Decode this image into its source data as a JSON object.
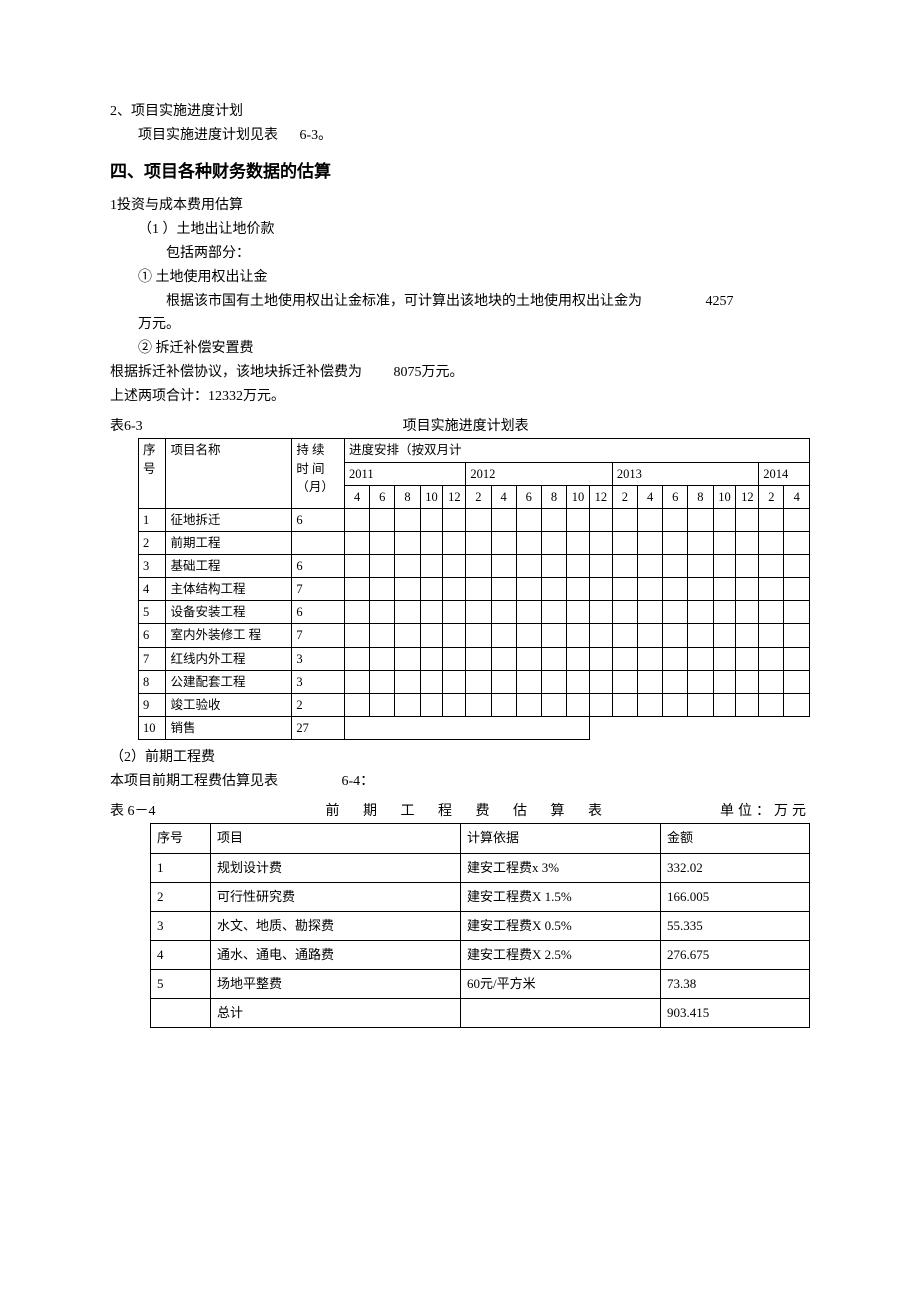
{
  "p1": "2、项目实施进度计划",
  "p2_a": "项目实施进度计划见表",
  "p2_b": "6-3。",
  "h4": "四、项目各种财务数据的估算",
  "p3": "1投资与成本费用估算",
  "p4": "（1 ）土地出让地价款",
  "p5": "包括两部分：",
  "p6": "① 土地使用权出让金",
  "p7_a": "根据该市国有土地使用权出让金标准，可计算出该地块的土地使用权出让金为",
  "p7_b": "4257",
  "p8": "万元。",
  "p9": "② 拆迁补偿安置费",
  "p10_a": "根据拆迁补偿协议，该地块拆迁补偿费为",
  "p10_b": "8075万元。",
  "p11": "上述两项合计：12332万元。",
  "t63_label": "表6-3",
  "t63_title": "项目实施进度计划表",
  "t63": {
    "h_seq": "序号",
    "h_name": "项目名称",
    "h_dur_a": "持",
    "h_dur_b": "续",
    "h_time": "时 间（月）",
    "h_prog": "进度安排（按双月计",
    "y2011": "2011",
    "y2012": "2012",
    "y2013": "2013",
    "y2014": "2014",
    "m4": "4",
    "m6": "6",
    "m8": "8",
    "m10": "10",
    "m12": "12",
    "m2": "2",
    "rows": [
      {
        "n": "1",
        "name": "征地拆迁",
        "dur": "6"
      },
      {
        "n": "2",
        "name": "前期工程",
        "dur": ""
      },
      {
        "n": "3",
        "name": "基础工程",
        "dur": "6"
      },
      {
        "n": "4",
        "name": "主体结构工程",
        "dur": "7"
      },
      {
        "n": "5",
        "name": "设备安装工程",
        "dur": "6"
      },
      {
        "n": "6",
        "name": "室内外装修工 程",
        "dur": "7"
      },
      {
        "n": "7",
        "name": "红线内外工程",
        "dur": "3"
      },
      {
        "n": "8",
        "name": "公建配套工程",
        "dur": "3"
      },
      {
        "n": "9",
        "name": "竣工验收",
        "dur": "2"
      },
      {
        "n": "10",
        "name": "销售",
        "dur": "27"
      }
    ]
  },
  "p12": "（2）前期工程费",
  "p13_a": "本项目前期工程费估算见表",
  "p13_b": "6-4：",
  "t64_label": "表 6－4",
  "t64_title": "前 期 工 程 费 估 算 表",
  "t64_unit": "单位：万元",
  "t64": {
    "h_seq": "序号",
    "h_item": "项目",
    "h_basis": "计算依据",
    "h_amt": "金额",
    "rows": [
      {
        "n": "1",
        "item": "规划设计费",
        "basis": "建安工程费x 3%",
        "amt": "332.02"
      },
      {
        "n": "2",
        "item": "可行性研究费",
        "basis": "建安工程费X 1.5%",
        "amt": "166.005"
      },
      {
        "n": "3",
        "item": "水文、地质、勘探费",
        "basis": "建安工程费X 0.5%",
        "amt": "55.335"
      },
      {
        "n": "4",
        "item": "通水、通电、通路费",
        "basis": "建安工程费X 2.5%",
        "amt": "276.675"
      },
      {
        "n": "5",
        "item": "场地平整费",
        "basis": "60元/平方米",
        "amt": "73.38"
      },
      {
        "n": "",
        "item": "总计",
        "basis": "",
        "amt": "903.415"
      }
    ]
  }
}
